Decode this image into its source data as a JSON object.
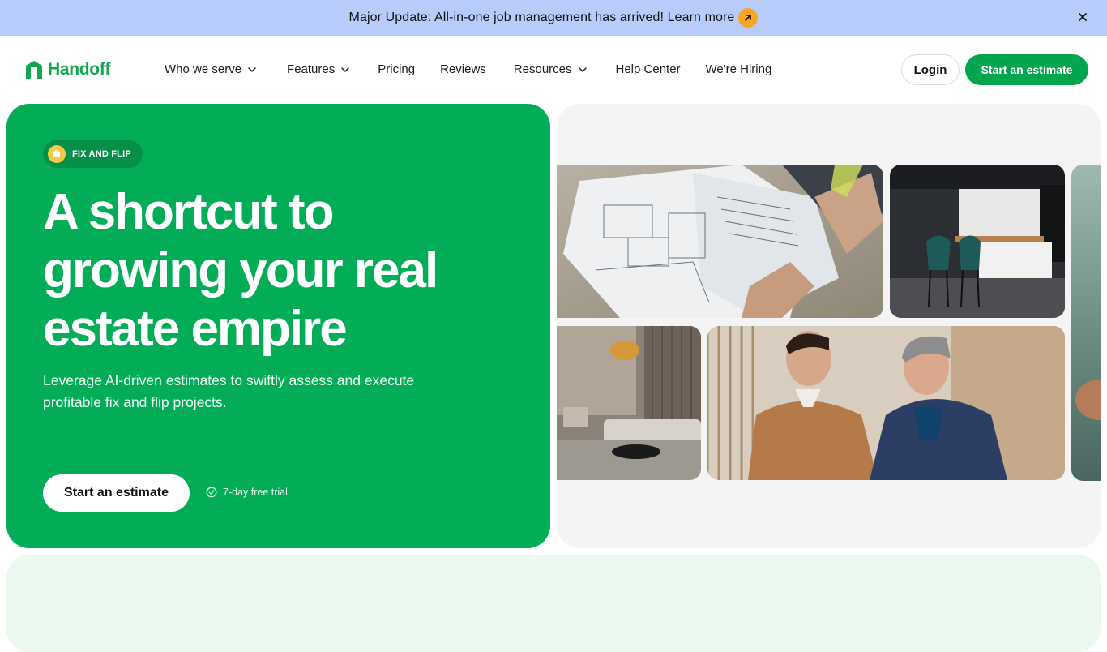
{
  "announcement": {
    "text": "Major Update: All-in-one job management has arrived! Learn more",
    "arrow_icon": "arrow-up-right-icon",
    "close_icon": "close-icon"
  },
  "nav": {
    "logo_text": "Handoff",
    "links": [
      {
        "label": "Who we serve",
        "dropdown": true
      },
      {
        "label": "Features",
        "dropdown": true
      },
      {
        "label": "Pricing",
        "dropdown": false
      },
      {
        "label": "Reviews",
        "dropdown": false
      },
      {
        "label": "Resources",
        "dropdown": true
      },
      {
        "label": "Help Center",
        "dropdown": false
      },
      {
        "label": "We're Hiring",
        "dropdown": false
      }
    ],
    "login_label": "Login",
    "start_label": "Start an estimate"
  },
  "hero": {
    "badge": "FIX AND FLIP",
    "title": "A shortcut to growing your real estate empire",
    "subtitle": "Leverage AI-driven estimates to swiftly assess and execute profitable fix and flip projects.",
    "cta_label": "Start an estimate",
    "trial_text": "7-day free trial"
  },
  "colors": {
    "brand_green": "#03ad58",
    "announcement_bg": "#b8ccfb",
    "accent_orange": "#f5a623"
  }
}
